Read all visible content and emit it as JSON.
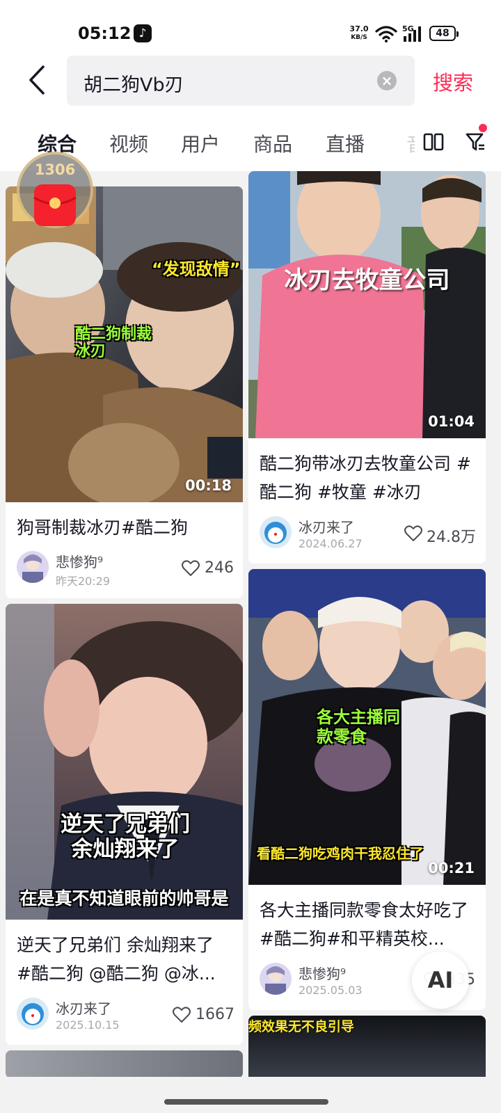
{
  "status_bar": {
    "time": "05:12",
    "net_speed_value": "37.0",
    "net_speed_unit": "KB/S",
    "network": "5G",
    "battery": "48"
  },
  "search": {
    "query": "胡二狗Vb刃",
    "button": "搜索"
  },
  "tabs": [
    {
      "label": "综合",
      "active": true
    },
    {
      "label": "视频"
    },
    {
      "label": "用户"
    },
    {
      "label": "商品"
    },
    {
      "label": "直播"
    }
  ],
  "tab_overflow": "音",
  "red_packet": {
    "count": "1306"
  },
  "feed": {
    "left": [
      {
        "thumb_texts": [
          "“发现敌情”",
          "酷二狗制裁\n冰刃"
        ],
        "duration": "00:18",
        "title": "狗哥制裁冰刃#酷二狗",
        "author": "悲惨狗⁹",
        "date": "昨天20:29",
        "likes": "246"
      },
      {
        "thumb_texts": [
          "逆天了兄弟们\n余灿翔来了",
          "在是真不知道眼前的帅哥是"
        ],
        "title": "逆天了兄弟们 余灿翔来了 #酷二狗 @酷二狗 @冰...",
        "author": "冰刃来了",
        "date": "2025.10.15",
        "likes": "1667"
      }
    ],
    "right": [
      {
        "thumb_texts": [
          "冰刃去牧童公司"
        ],
        "duration": "01:04",
        "title": "酷二狗带冰刃去牧童公司 #酷二狗 #牧童 #冰刃",
        "author": "冰刃来了",
        "date": "2024.06.27",
        "likes": "24.8万"
      },
      {
        "thumb_texts": [
          "各大主播同\n款零食",
          "看酷二狗吃鸡肉干我忍住了"
        ],
        "duration": "00:21",
        "title": "各大主播同款零食太好吃了#酷二狗#和平精英校...",
        "author": "悲惨狗⁹",
        "date": "2025.05.03",
        "likes": "835"
      },
      {
        "thumb_texts": [
          "频效果无不良引导"
        ]
      }
    ]
  },
  "ai_button": "AI",
  "colors": {
    "accent": "#fe2c55",
    "text": "#161823",
    "overlay_yellow": "#ffe92c",
    "overlay_green": "#9dff3a"
  }
}
